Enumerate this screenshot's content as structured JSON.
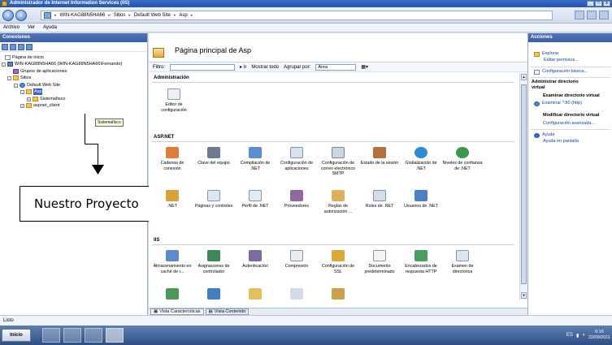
{
  "window": {
    "title": "Administrador de Internet Information Services (IIS)"
  },
  "breadcrumb": [
    "WIN-KAG88N5HA66",
    "Sitios",
    "Default Web Site",
    "Asp"
  ],
  "menu": [
    "Archivo",
    "Ver",
    "Ayuda"
  ],
  "connections": {
    "title": "Conexiones",
    "tree": [
      "Página de inicio",
      "WIN-KAG88N5HA66 (WIN-KAG88N5HA66\\Fernando)",
      "Grupos de aplicaciones",
      "Sitios",
      "Default Web Site",
      "Asp",
      "SistemaItsco",
      "aspnet_client"
    ],
    "tooltip": "SistemaItsco"
  },
  "callout": {
    "text": "Nuestro Proyecto"
  },
  "main": {
    "title": "Página principal de Asp",
    "filter_label": "Filtro:",
    "show_all": "Mostrar todo",
    "group_by": "Agrupar por:",
    "group_value": "Área"
  },
  "sections": {
    "administracion": {
      "title": "Administración",
      "items": [
        "Editor de configuración"
      ]
    },
    "aspnet": {
      "title": "ASP.NET",
      "row1": [
        "Cadenas de conexión",
        "Clave del equipo",
        "Compilación de .NET",
        "Configuración de aplicaciones",
        "Configuración de correo electrónico SMTP",
        "Estado de la sesión",
        "Globalización de .NET",
        "Niveles de confianza de .NET"
      ],
      "row2": [
        ".NET",
        "Páginas y controles",
        "Perfil de .NET",
        "Proveedores",
        "Reglas de autorización ...",
        "Roles de .NET",
        "Usuarios de .NET"
      ]
    },
    "iis": {
      "title": "IIS",
      "items": [
        "Almacenamiento en caché de r...",
        "Asignaciones de controlador",
        "Autenticación",
        "Compresión",
        "Configuración de SSL",
        "Documento predeterminado",
        "Encabezados de respuesta HTTP",
        "Examen de directorios"
      ]
    }
  },
  "bottom_tabs": [
    "Vista Características",
    "Vista Contenido"
  ],
  "actions": {
    "title": "Acciones",
    "explore": "Explorar",
    "edit_perms": "Editar permisos...",
    "basic_config": "Configuración básica...",
    "admin_dir_line1": "Administrar directorio",
    "admin_dir_line2": "virtual",
    "browse_dir": "Examinar directorio virtual",
    "browse_port": "Examinar *:80 (http)",
    "modify_dir": "Modificar directorio virtual",
    "advanced_config": "Configuración avanzada...",
    "help": "Ayuda",
    "online_help": "Ayuda en pantalla"
  },
  "status": {
    "text": "Listo"
  },
  "taskbar": {
    "start": "Inicio",
    "lang": "ES",
    "time": "0:16",
    "date": "22/09/2011"
  },
  "colors": {
    "accent": "#3166c2",
    "title": "#2553a8"
  }
}
